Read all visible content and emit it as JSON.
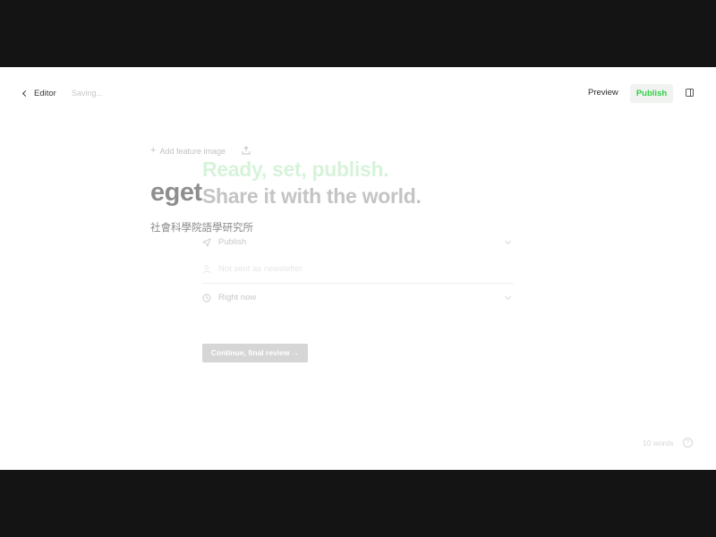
{
  "topbar": {
    "back_label": "Editor",
    "status_text": "Saving...",
    "preview_label": "Preview",
    "publish_label": "Publish"
  },
  "post": {
    "feature_image_label": "Add feature image",
    "title": "eget",
    "body": "社會科學院語學研究所"
  },
  "publish_flow": {
    "hero_line1": "Ready, set, publish.",
    "hero_line2": "Share it with the world.",
    "options": [
      {
        "label": "Publish",
        "icon": "paper-plane-icon"
      },
      {
        "label": "Not sent as newsletter",
        "icon": "user-icon"
      },
      {
        "label": "Right now",
        "icon": "clock-icon"
      }
    ],
    "continue_label": "Continue, final review →"
  },
  "footer": {
    "word_count": "10 words",
    "help_glyph": "?"
  },
  "colors": {
    "accent_green": "#30cf43",
    "hero_green_faded": "#d6f3da"
  }
}
